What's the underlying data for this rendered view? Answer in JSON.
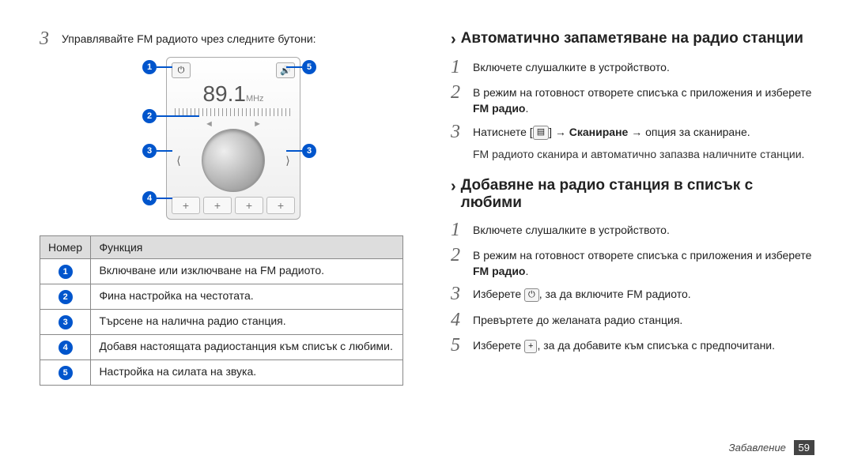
{
  "left": {
    "step3_text": "Управлявайте FM радиото чрез следните бутони:",
    "freq": "89.1",
    "mhz": "MHz",
    "table_header_num": "Номер",
    "table_header_func": "Функция",
    "rows": [
      "Включване или изключване на FM радиото.",
      "Фина настройка на честотата.",
      "Търсене на налична радио станция.",
      "Добавя настоящата радиостанция към списък с любими.",
      "Настройка на силата на звука."
    ]
  },
  "right": {
    "sect1_title": "Автоматично запаметяване на радио станции",
    "s1_step1": "Включете слушалките в устройството.",
    "s1_step2_a": "В режим на готовност отворете списъка с приложения и изберете ",
    "s1_step2_b": "FM радио",
    "s1_step2_c": ".",
    "s1_step3_a": "Натиснете [",
    "s1_step3_b": "] → ",
    "s1_step3_c": "Сканиране",
    "s1_step3_d": " → опция за сканиране.",
    "s1_note": "FM радиото сканира и автоматично запазва наличните станции.",
    "sect2_title": "Добавяне на радио станция в списък с любими",
    "s2_step1": "Включете слушалките в устройството.",
    "s2_step2_a": "В режим на готовност отворете списъка с приложения и изберете ",
    "s2_step2_b": "FM радио",
    "s2_step2_c": ".",
    "s2_step3_a": "Изберете ",
    "s2_step3_b": ", за да включите FM радиото.",
    "s2_step4": "Превъртете до желаната радио станция.",
    "s2_step5_a": "Изберете ",
    "s2_step5_b": ", за да добавите към списъка с предпочитани."
  },
  "footer_label": "Забавление",
  "footer_page": "59"
}
